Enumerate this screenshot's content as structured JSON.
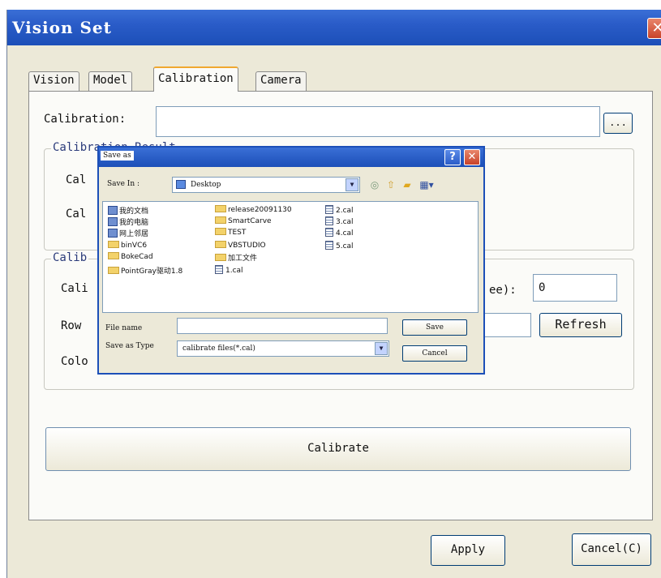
{
  "window": {
    "title": "Vision Set",
    "close_glyph": "✕"
  },
  "tabs": [
    {
      "label": "Vision"
    },
    {
      "label": "Model"
    },
    {
      "label": "Calibration",
      "active": true
    },
    {
      "label": "Camera"
    }
  ],
  "calibration": {
    "label": "Calibration:",
    "path_value": "",
    "browse_label": "...",
    "result_group_label": "Calibration Result",
    "row1_label": "Cal",
    "row2_label": "Cal",
    "settings_group_label": "Calib",
    "cali_label": "Cali",
    "degree_label": "ee):",
    "degree_value": "0",
    "row_label": "Row",
    "refresh_label": "Refresh",
    "color_label": "Colo",
    "calibrate_label": "Calibrate"
  },
  "footer": {
    "apply_label": "Apply",
    "cancel_label": "Cancel(C)"
  },
  "save_dialog": {
    "title": "Save as",
    "help_glyph": "?",
    "close_glyph": "✕",
    "save_in_label": "Save In :",
    "save_in_value": "Desktop",
    "files": [
      {
        "name": "我的文档",
        "icon": "documents-icon"
      },
      {
        "name": "我的电脑",
        "icon": "computer-icon"
      },
      {
        "name": "网上邻居",
        "icon": "network-icon"
      },
      {
        "name": "binVC6",
        "icon": "folder-icon"
      },
      {
        "name": "BokeCad",
        "icon": "folder-icon"
      },
      {
        "name": "PointGray驱动1.8",
        "icon": "folder-icon"
      },
      {
        "name": "release20091130",
        "icon": "folder-icon"
      },
      {
        "name": "SmartCarve",
        "icon": "folder-icon"
      },
      {
        "name": "TEST",
        "icon": "folder-icon"
      },
      {
        "name": "VBSTUDIO",
        "icon": "folder-icon"
      },
      {
        "name": "加工文件",
        "icon": "folder-icon"
      },
      {
        "name": "1.cal",
        "icon": "cal-file-icon"
      },
      {
        "name": "2.cal",
        "icon": "cal-file-icon"
      },
      {
        "name": "3.cal",
        "icon": "cal-file-icon"
      },
      {
        "name": "4.cal",
        "icon": "cal-file-icon"
      },
      {
        "name": "5.cal",
        "icon": "cal-file-icon"
      }
    ],
    "file_name_label": "File name",
    "file_name_value": "",
    "type_label": "Save as Type",
    "type_value": "calibrate files(*.cal)",
    "save_label": "Save",
    "cancel_label": "Cancel"
  }
}
